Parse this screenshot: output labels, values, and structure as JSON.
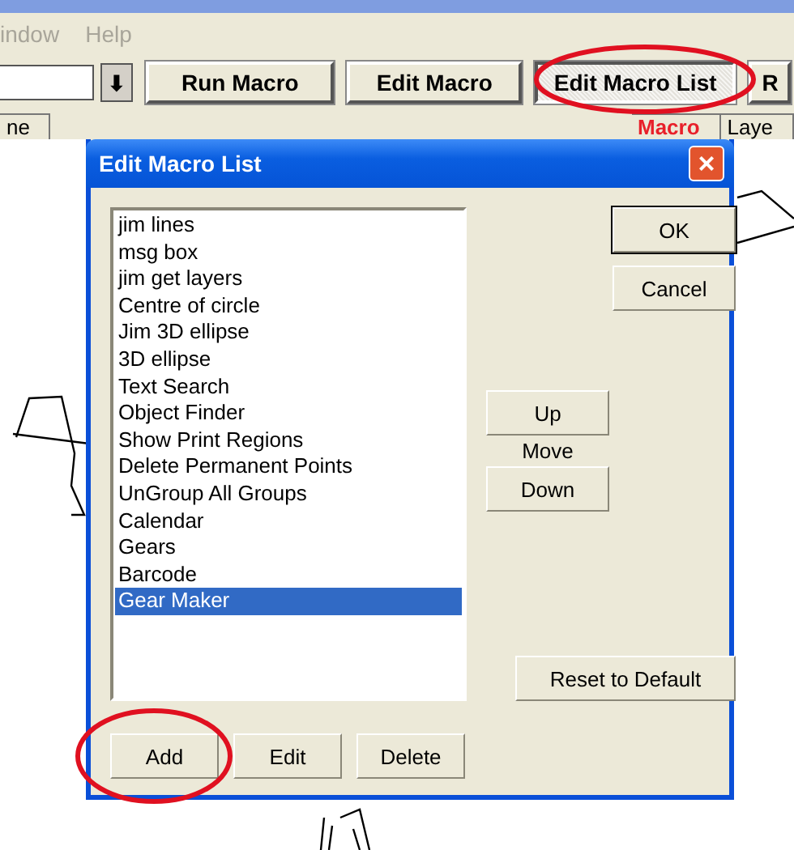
{
  "menu": [
    {
      "label": "indow",
      "disabled": true
    },
    {
      "label": "Help",
      "disabled": true
    }
  ],
  "toolbar": {
    "combo_arrow": "⬇",
    "buttons": [
      {
        "label": "Run Macro",
        "selected": false
      },
      {
        "label": "Edit Macro",
        "selected": false
      },
      {
        "label": "Edit Macro List",
        "selected": true
      },
      {
        "label": "R",
        "selected": false
      }
    ]
  },
  "tabs": [
    {
      "label": "ne",
      "selected": false
    },
    {
      "label": "Macro",
      "selected": true
    },
    {
      "label": "Laye",
      "selected": false
    }
  ],
  "dialog": {
    "title": "Edit Macro List",
    "close": "×",
    "items": [
      {
        "label": "jim lines",
        "selected": false
      },
      {
        "label": "msg box",
        "selected": false
      },
      {
        "label": "jim get layers",
        "selected": false
      },
      {
        "label": "Centre of circle",
        "selected": false
      },
      {
        "label": "Jim 3D ellipse",
        "selected": false
      },
      {
        "label": "3D ellipse",
        "selected": false
      },
      {
        "label": "Text Search",
        "selected": false
      },
      {
        "label": "Object Finder",
        "selected": false
      },
      {
        "label": "Show Print Regions",
        "selected": false
      },
      {
        "label": "Delete Permanent Points",
        "selected": false
      },
      {
        "label": "UnGroup All Groups",
        "selected": false
      },
      {
        "label": "Calendar",
        "selected": false
      },
      {
        "label": "Gears",
        "selected": false
      },
      {
        "label": "Barcode",
        "selected": false
      },
      {
        "label": "Gear Maker",
        "selected": true
      }
    ],
    "ok": "OK",
    "cancel": "Cancel",
    "up": "Up",
    "move": "Move",
    "down": "Down",
    "reset": "Reset to Default",
    "bottom_buttons": [
      "Add",
      "Edit",
      "Delete"
    ]
  }
}
